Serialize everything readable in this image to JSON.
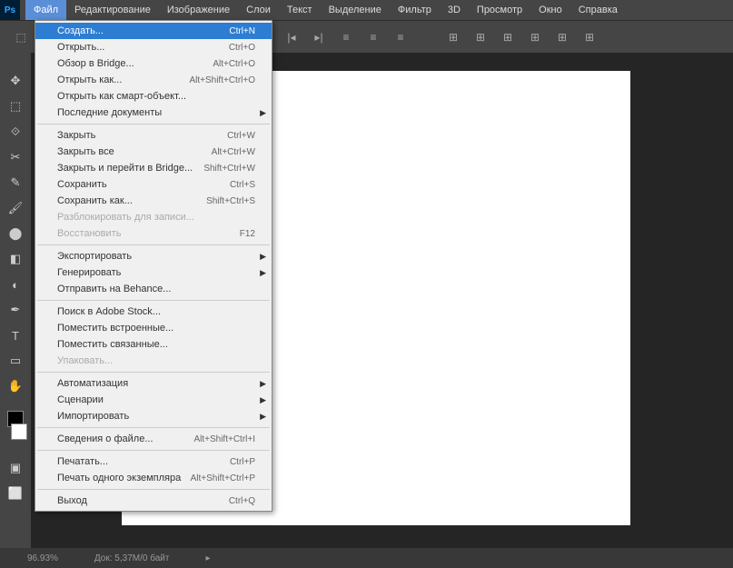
{
  "menubar": {
    "logo": "Ps",
    "items": [
      "Файл",
      "Редактирование",
      "Изображение",
      "Слои",
      "Текст",
      "Выделение",
      "Фильтр",
      "3D",
      "Просмотр",
      "Окно",
      "Справка"
    ]
  },
  "fileMenu": {
    "groups": [
      [
        {
          "label": "Создать...",
          "shortcut": "Ctrl+N",
          "selected": true
        },
        {
          "label": "Открыть...",
          "shortcut": "Ctrl+O"
        },
        {
          "label": "Обзор в Bridge...",
          "shortcut": "Alt+Ctrl+O"
        },
        {
          "label": "Открыть как...",
          "shortcut": "Alt+Shift+Ctrl+O"
        },
        {
          "label": "Открыть как смарт-объект..."
        },
        {
          "label": "Последние документы",
          "submenu": true
        }
      ],
      [
        {
          "label": "Закрыть",
          "shortcut": "Ctrl+W"
        },
        {
          "label": "Закрыть все",
          "shortcut": "Alt+Ctrl+W"
        },
        {
          "label": "Закрыть и перейти в Bridge...",
          "shortcut": "Shift+Ctrl+W"
        },
        {
          "label": "Сохранить",
          "shortcut": "Ctrl+S"
        },
        {
          "label": "Сохранить как...",
          "shortcut": "Shift+Ctrl+S"
        },
        {
          "label": "Разблокировать для записи...",
          "disabled": true
        },
        {
          "label": "Восстановить",
          "shortcut": "F12",
          "disabled": true
        }
      ],
      [
        {
          "label": "Экспортировать",
          "submenu": true
        },
        {
          "label": "Генерировать",
          "submenu": true
        },
        {
          "label": "Отправить на Behance..."
        }
      ],
      [
        {
          "label": "Поиск в Adobe Stock..."
        },
        {
          "label": "Поместить встроенные..."
        },
        {
          "label": "Поместить связанные..."
        },
        {
          "label": "Упаковать...",
          "disabled": true
        }
      ],
      [
        {
          "label": "Автоматизация",
          "submenu": true
        },
        {
          "label": "Сценарии",
          "submenu": true
        },
        {
          "label": "Импортировать",
          "submenu": true
        }
      ],
      [
        {
          "label": "Сведения о файле...",
          "shortcut": "Alt+Shift+Ctrl+I"
        }
      ],
      [
        {
          "label": "Печатать...",
          "shortcut": "Ctrl+P"
        },
        {
          "label": "Печать одного экземпляра",
          "shortcut": "Alt+Shift+Ctrl+P"
        }
      ],
      [
        {
          "label": "Выход",
          "shortcut": "Ctrl+Q"
        }
      ]
    ]
  },
  "status": {
    "zoom": "96.93%",
    "doc": "Док: 5,37M/0 байт"
  }
}
